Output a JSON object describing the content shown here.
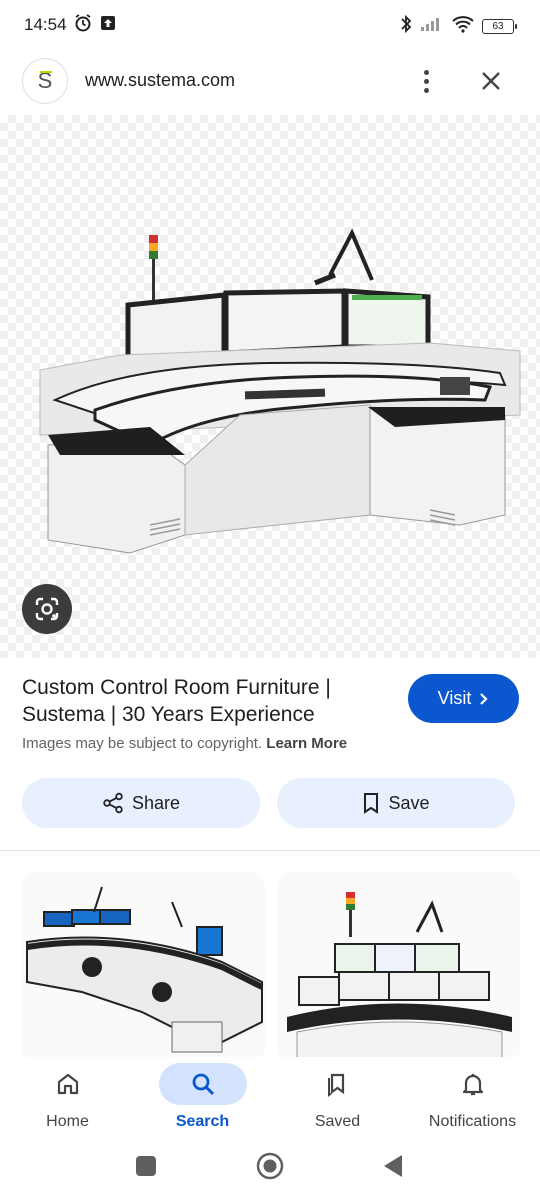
{
  "status_bar": {
    "time": "14:54",
    "battery": "63",
    "icons": [
      "alarm-icon",
      "upload-icon",
      "bluetooth-icon",
      "signal-icon",
      "wifi-icon",
      "battery-icon"
    ]
  },
  "url_bar": {
    "logo_letter": "S",
    "url": "www.sustema.com",
    "icons": [
      "more-vert-icon",
      "close-icon"
    ]
  },
  "result": {
    "title": "Custom Control Room Furniture | Sustema | 30 Years Experience",
    "visit_label": "Visit",
    "copyright_text": "Images may be subject to copyright.",
    "learn_more": "Learn More",
    "share_label": "Share",
    "save_label": "Save"
  },
  "bottom_nav": {
    "items": [
      {
        "label": "Home",
        "icon": "home-icon",
        "active": false
      },
      {
        "label": "Search",
        "icon": "search-icon",
        "active": true
      },
      {
        "label": "Saved",
        "icon": "bookmarks-icon",
        "active": false
      },
      {
        "label": "Notifications",
        "icon": "bell-icon",
        "active": false
      }
    ]
  },
  "colors": {
    "accent": "#0b57d0",
    "button_tint": "#e8f0fe",
    "active_pill": "#d3e3fd"
  }
}
